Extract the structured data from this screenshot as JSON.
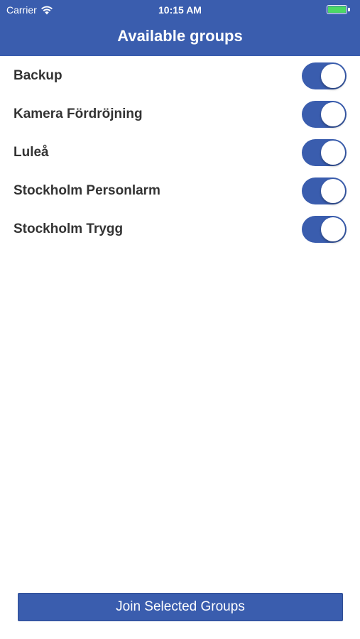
{
  "status_bar": {
    "carrier": "Carrier",
    "wifi_icon": "wifi-icon",
    "time": "10:15 AM",
    "battery_icon": "battery-full-icon",
    "battery_color": "#4cd964"
  },
  "nav": {
    "title": "Available groups",
    "background_color": "#3a5dae"
  },
  "groups": [
    {
      "label": "Backup",
      "enabled": true
    },
    {
      "label": "Kamera Fördröjning",
      "enabled": true
    },
    {
      "label": "Luleå",
      "enabled": true
    },
    {
      "label": "Stockholm Personlarm",
      "enabled": true
    },
    {
      "label": "Stockholm Trygg",
      "enabled": true
    }
  ],
  "footer": {
    "join_label": "Join Selected Groups"
  }
}
